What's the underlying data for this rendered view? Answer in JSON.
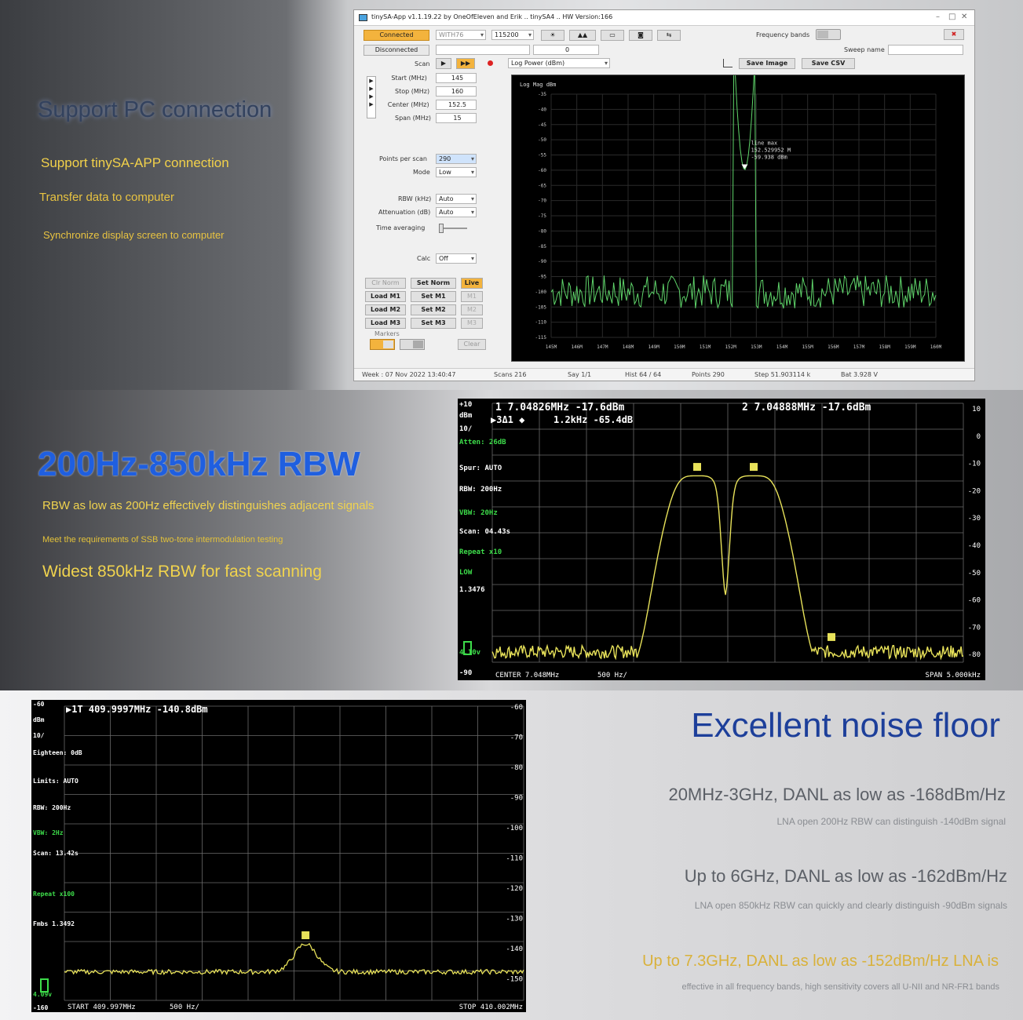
{
  "panel1": {
    "title": "Support PC connection",
    "lines": [
      "Support tinySA-APP connection",
      "Transfer data to computer",
      "Synchronize display screen to computer"
    ],
    "colors": {
      "title": "#33425e",
      "line1": "#f2d14a",
      "line2": "#e8c341",
      "line3": "#e8c341"
    }
  },
  "app": {
    "title": "tinySA-App v1.1.19.22 by OneOfEleven and Erik .. tinySA4 .. HW Version:166",
    "connected_label": "Connected",
    "disconnected_label": "Disconnected",
    "port_value": "WITH76",
    "baud_value": "115200",
    "small_value": "0",
    "frequency_bands_label": "Frequency bands",
    "sweep_name_label": "Sweep name",
    "scan_label": "Scan",
    "trace_mode": "Log Power (dBm)",
    "save_image_label": "Save Image",
    "save_csv_label": "Save CSV",
    "fields": [
      {
        "label": "Start (MHz)",
        "value": "145"
      },
      {
        "label": "Stop (MHz)",
        "value": "160"
      },
      {
        "label": "Center (MHz)",
        "value": "152.5"
      },
      {
        "label": "Span (MHz)",
        "value": "15"
      }
    ],
    "points_label": "Points per scan",
    "points_value": "290",
    "mode_label": "Mode",
    "mode_value": "Low",
    "rbw_label": "RBW (kHz)",
    "rbw_value": "Auto",
    "atten_label": "Attenuation (dB)",
    "atten_value": "Auto",
    "time_avg_label": "Time averaging",
    "calc_label": "Calc",
    "calc_value": "Off",
    "clr_norm_label": "Clr Norm",
    "set_norm_label": "Set Norm",
    "live_label": "Live",
    "load_buttons": [
      "Load M1",
      "Load M2",
      "Load M3"
    ],
    "set_buttons": [
      "Set M1",
      "Set M2",
      "Set M3"
    ],
    "mem_buttons": [
      "M1",
      "M2",
      "M3"
    ],
    "markers_label": "Markers",
    "clear_label": "Clear",
    "status": [
      "Week : 07 Nov 2022 13:40:47",
      "Scans 216",
      "Say 1/1",
      "Hist 64 / 64",
      "Points 290",
      "Step 51.903114 k",
      "Bat 3.928 V"
    ]
  },
  "plot1": {
    "ylabel": "Log Mag dBm",
    "yticks": [
      "-35",
      "-40",
      "-45",
      "-50",
      "-55",
      "-60",
      "-65",
      "-70",
      "-75",
      "-80",
      "-85",
      "-90",
      "-95",
      "-100",
      "-105",
      "-110",
      "-115"
    ],
    "xticks": [
      "145M",
      "146M",
      "147M",
      "148M",
      "149M",
      "150M",
      "151M",
      "152M",
      "153M",
      "154M",
      "155M",
      "156M",
      "157M",
      "158M",
      "159M",
      "160M"
    ],
    "marker_text": [
      "line max",
      "152.529952 M",
      "-59.938 dBm"
    ],
    "trace_color": "#5fd46a"
  },
  "panel2": {
    "title": "200Hz-850kHz RBW",
    "lines": [
      "RBW as low as 200Hz effectively distinguishes adjacent signals",
      "Meet the requirements of SSB two-tone intermodulation testing",
      "Widest 850kHz RBW for fast scanning"
    ],
    "colors": {
      "title": "#1f5fe0",
      "line1": "#f0d34e",
      "line2": "#e3c23a",
      "line3": "#f0d34e"
    }
  },
  "chart2": {
    "header1": "1  7.04826MHz -17.6dBm",
    "header2": "2  7.04888MHz -17.6dBm",
    "delta": "▶3Δ1 ◆",
    "delta_value": "1.2kHz -65.4dB",
    "left_labels": [
      "+10",
      "dBm",
      "10/",
      "Atten: 26dB",
      "Spur: AUTO",
      "RBW: 200Hz",
      "VBW: 20Hz",
      "Scan: 04.43s",
      "Repeat x10",
      "LOW",
      "1.3476",
      "4.10v",
      "-90"
    ],
    "right_ticks": [
      "10",
      "0",
      "-10",
      "-20",
      "-30",
      "-40",
      "-50",
      "-60",
      "-70",
      "-80"
    ],
    "bottom_center": "CENTER 7.048MHz",
    "bottom_div": "500 Hz/",
    "bottom_span": "SPAN 5.000kHz",
    "trace_color": "#e8e25a"
  },
  "panel3": {
    "title": "Excellent noise floor",
    "lines": [
      "20MHz-3GHz, DANL as low as -168dBm/Hz",
      "LNA open 200Hz RBW can distinguish -140dBm signal",
      "Up to 6GHz, DANL as low as -162dBm/Hz",
      "LNA open 850kHz RBW can quickly and clearly distinguish -90dBm signals",
      "Up to 7.3GHz, DANL as low as -152dBm/Hz LNA is",
      "effective in all frequency bands, high sensitivity covers all U-NII and NR-FR1 bands"
    ],
    "colors": {
      "title": "#1d3f9a",
      "big": "#5b5f66",
      "small": "#8a8d92",
      "gold": "#d9b13a"
    }
  },
  "chart3": {
    "header": "▶1T 409.9997MHz -140.8dBm",
    "left_labels": [
      "-60",
      "dBm",
      "10/",
      "Eighteen: 0dB",
      "Limits: AUTO",
      "RBW: 200Hz",
      "VBW: 2Hz",
      "Scan: 13.42s",
      "Repeat x100",
      "Fmbs 1.3492",
      "4.09v",
      "-160"
    ],
    "right_ticks": [
      "-60",
      "-70",
      "-80",
      "-90",
      "-100",
      "-110",
      "-120",
      "-130",
      "-140",
      "-150"
    ],
    "bottom_start": "START 409.997MHz",
    "bottom_div": "500 Hz/",
    "bottom_stop": "STOP 410.002MHz",
    "trace_color": "#e8e25a"
  }
}
